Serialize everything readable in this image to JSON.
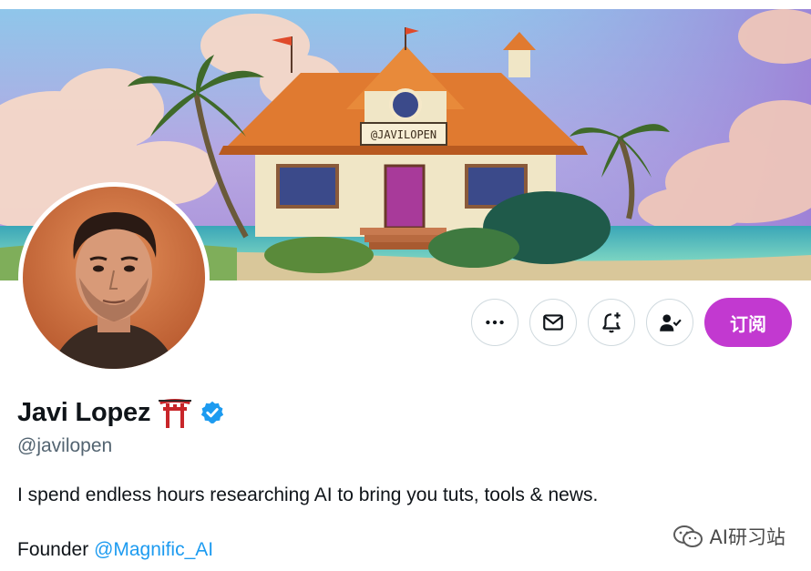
{
  "profile": {
    "display_name": "Javi Lopez",
    "name_emoji": "torii-gate-icon",
    "handle": "@javilopen",
    "bio": "I spend endless hours researching AI to bring you tuts, tools & news.",
    "founder_prefix": "Founder ",
    "founder_mention": "@Magnific_AI",
    "verified": true
  },
  "banner": {
    "sign_text": "@JAVILOPEN"
  },
  "actions": {
    "more_icon": "more-icon",
    "message_icon": "mail-icon",
    "notify_icon": "bell-plus-icon",
    "following_icon": "person-check-icon",
    "subscribe_label": "订阅"
  },
  "watermark": {
    "text": "AI研习站"
  },
  "colors": {
    "subscribe_bg": "#c239d0",
    "mention": "#1d9bf0",
    "verified": "#1d9bf0",
    "handle_gray": "#536471"
  }
}
